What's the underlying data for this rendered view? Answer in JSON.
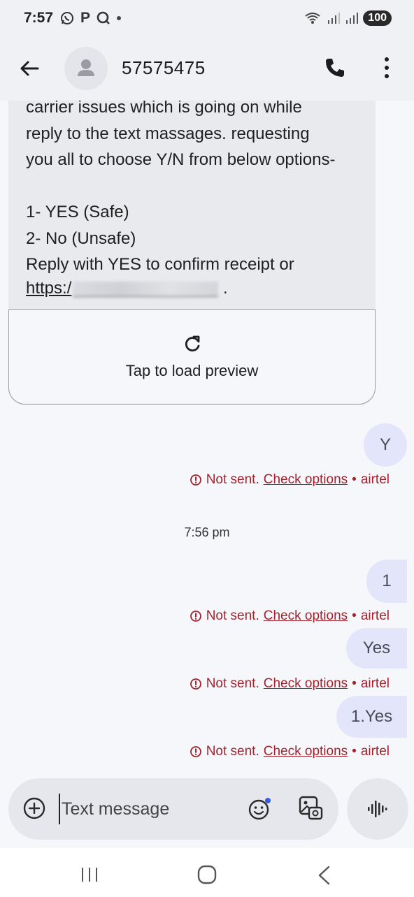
{
  "status_bar": {
    "time": "7:57",
    "letters": [
      "P"
    ],
    "battery": "100"
  },
  "header": {
    "contact": "57575475",
    "icons": [
      "back-arrow-icon",
      "avatar-icon",
      "phone-icon",
      "more-vert-icon"
    ]
  },
  "conversation": {
    "incoming": {
      "text": "carrier issues which is going on while\nreply to the text massages. requesting\nyou all to choose Y/N from below options-\n\n1- YES (Safe)\n2- No (Unsafe)\nReply with YES to confirm receipt or",
      "link_prefix": "https:/",
      "link_suffix": ".",
      "preview_label": "Tap to load preview"
    },
    "timestamp": "7:56 pm",
    "outgoing": [
      {
        "text": "Y",
        "status": "Not sent.",
        "action": "Check options",
        "carrier": "airtel"
      },
      {
        "text": "1",
        "status": "Not sent.",
        "action": "Check options",
        "carrier": "airtel"
      },
      {
        "text": "Yes",
        "status": "Not sent.",
        "action": "Check options",
        "carrier": "airtel"
      },
      {
        "text": "1.Yes",
        "status": "Not sent.",
        "action": "Check options",
        "carrier": "airtel"
      }
    ],
    "separator": "•"
  },
  "compose": {
    "placeholder": "Text message",
    "value": ""
  },
  "colors": {
    "error": "#a3232d",
    "outgoing_bubble": "#e3e6fa",
    "incoming_bubble": "#e9eaee"
  }
}
